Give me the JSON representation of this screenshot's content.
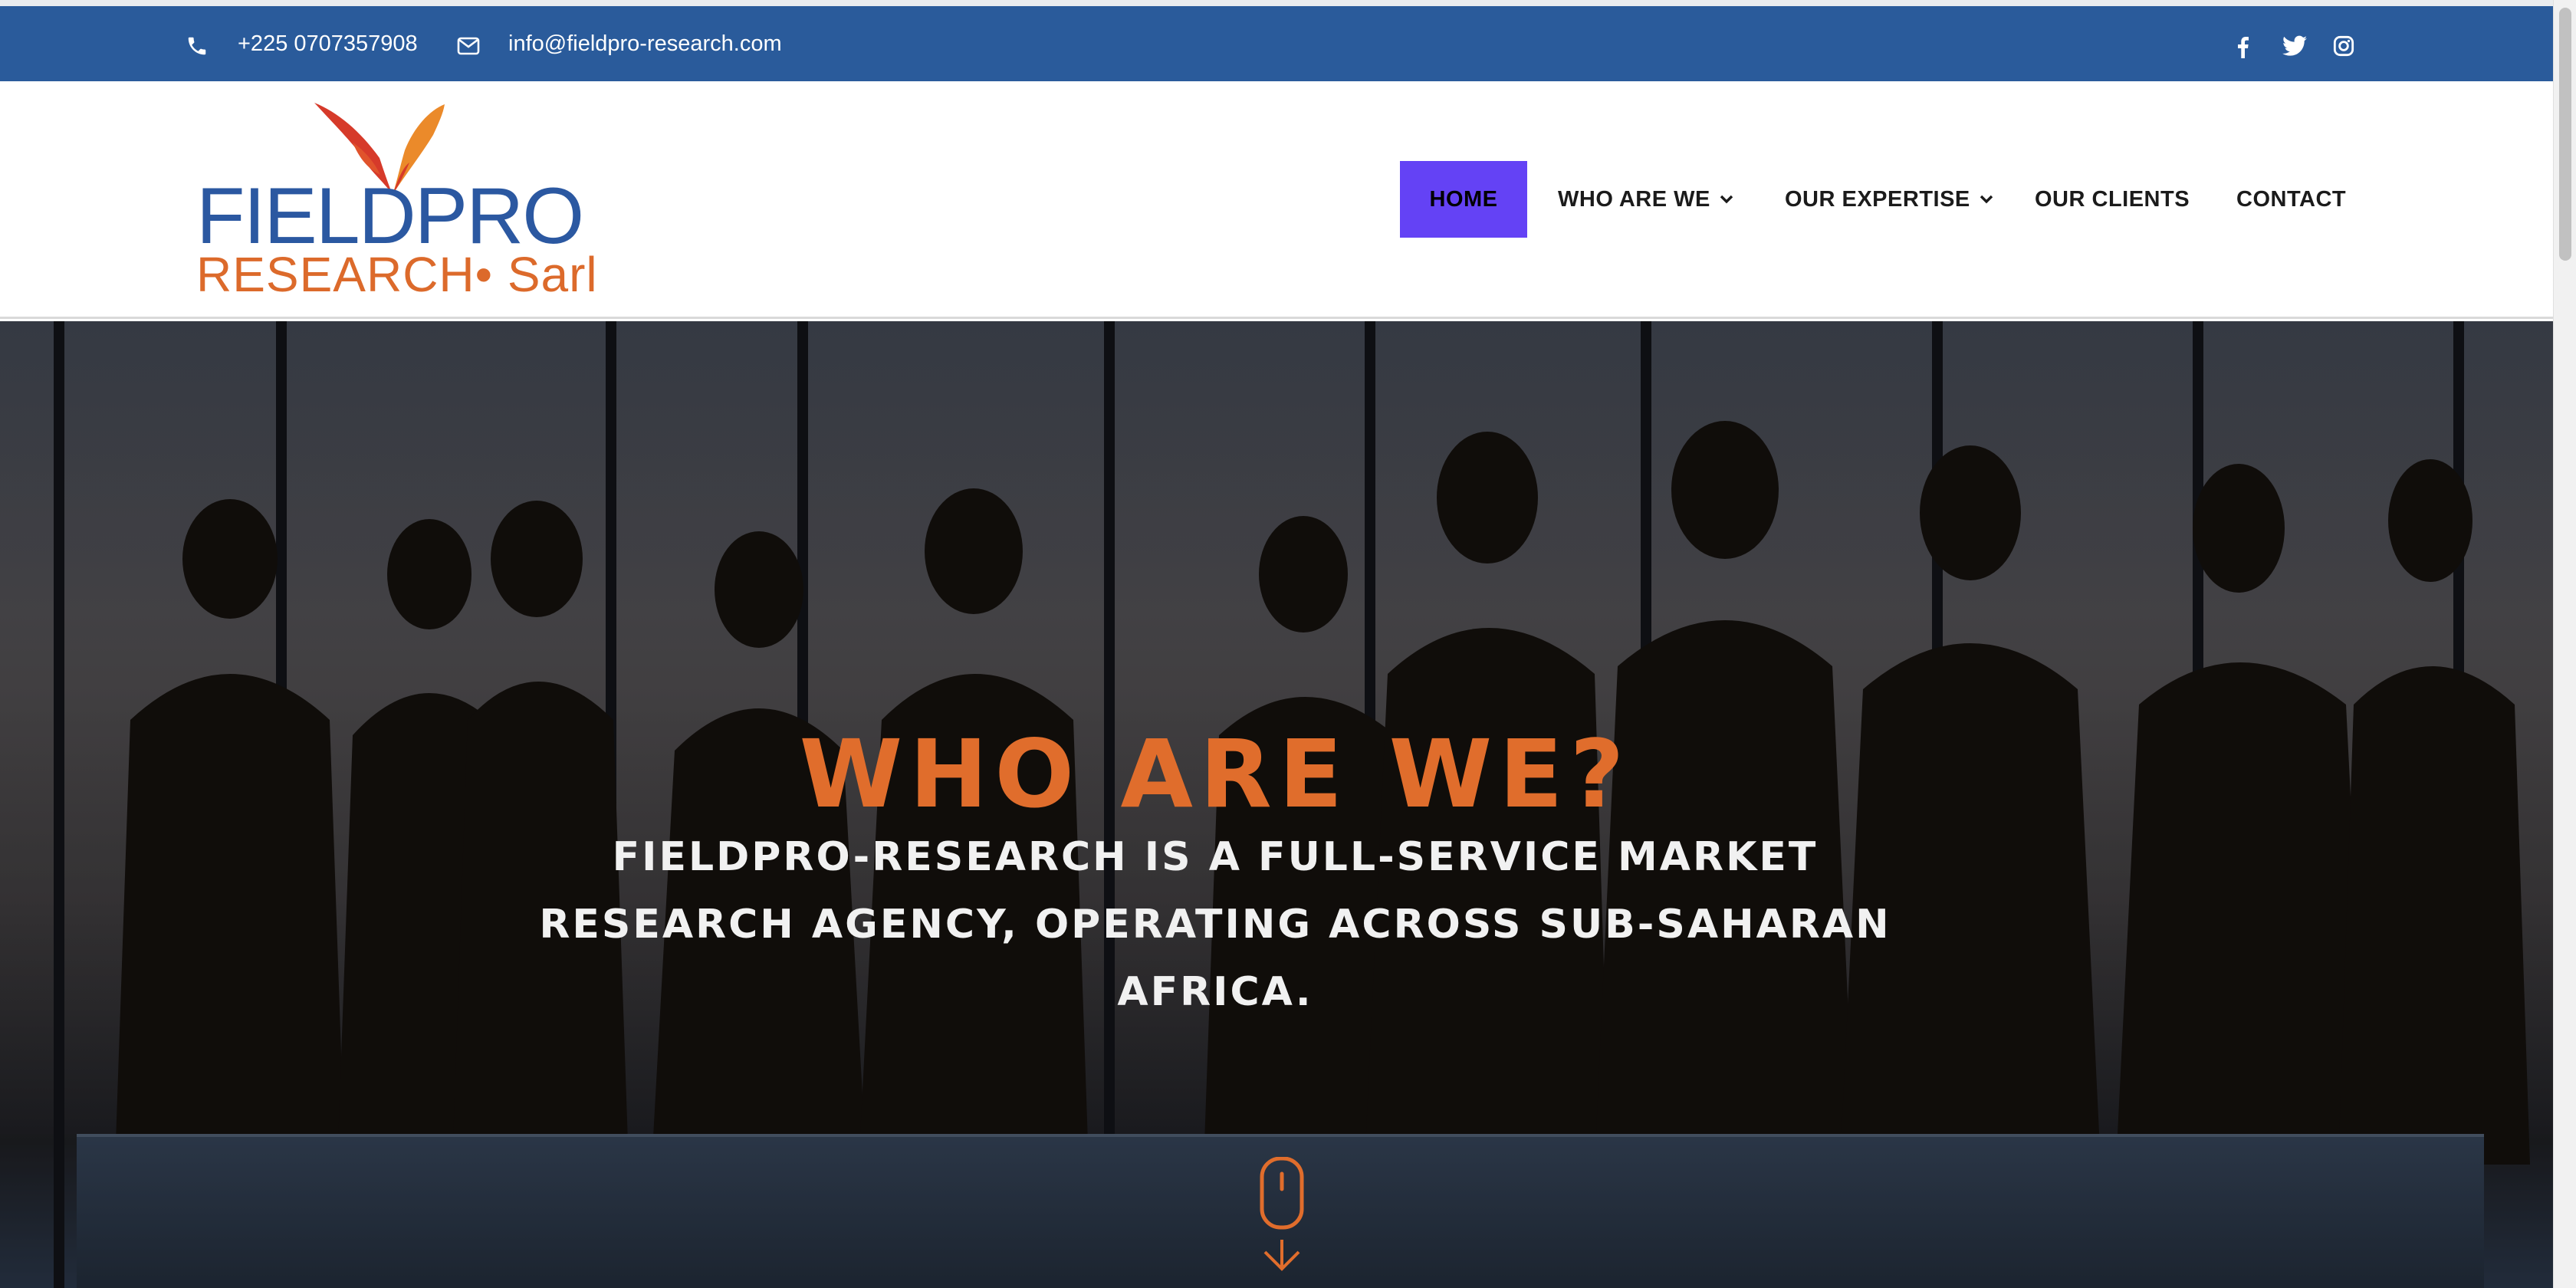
{
  "topbar": {
    "phone": "+225 0707357908",
    "email": "info@fieldpro-research.com",
    "icons": [
      "phone-icon",
      "mail-icon",
      "facebook-icon",
      "twitter-icon",
      "instagram-icon"
    ],
    "background": "#2a5b9b"
  },
  "logo": {
    "line1": "FIELDPRO",
    "line2": "RESEARCH• Sarl",
    "colors": {
      "blue": "#2b58a1",
      "orange": "#dc6a2b",
      "red": "#d63a2a"
    }
  },
  "nav": {
    "items": [
      {
        "label": "HOME",
        "active": true,
        "dropdown": false
      },
      {
        "label": "WHO ARE WE",
        "active": false,
        "dropdown": true
      },
      {
        "label": "OUR EXPERTISE",
        "active": false,
        "dropdown": true
      },
      {
        "label": "OUR CLIENTS",
        "active": false,
        "dropdown": false
      },
      {
        "label": "CONTACT",
        "active": false,
        "dropdown": false
      }
    ],
    "active_color": "#6442f5"
  },
  "hero": {
    "title": "WHO ARE WE?",
    "subtitle": "FIELDPRO-RESEARCH IS A FULL-SERVICE MARKET RESEARCH AGENCY, OPERATING ACROSS SUB-SAHARAN AFRICA.",
    "title_color": "#e06d2c",
    "scroll_icon": "mouse-scroll-down-icon"
  }
}
